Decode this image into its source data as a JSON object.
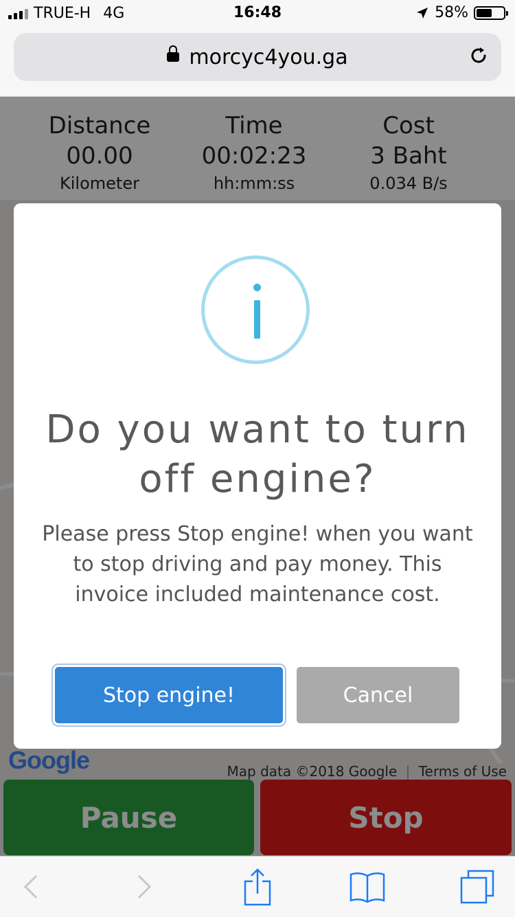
{
  "status_bar": {
    "carrier": "TRUE-H",
    "network": "4G",
    "time": "16:48",
    "battery": "58%"
  },
  "browser": {
    "url": "morcyc4you.ga"
  },
  "stats": {
    "distance": {
      "title": "Distance",
      "value": "00.00",
      "unit": "Kilometer"
    },
    "time": {
      "title": "Time",
      "value": "00:02:23",
      "unit": "hh:mm:ss"
    },
    "cost": {
      "title": "Cost",
      "value": "3 Baht",
      "unit": "0.034 B/s"
    }
  },
  "map": {
    "logo": "Google",
    "credit": "Map data ©2018 Google",
    "terms": "Terms of Use"
  },
  "buttons": {
    "pause": "Pause",
    "stop": "Stop"
  },
  "dialog": {
    "title": "Do you want to turn off engine?",
    "body": "Please press Stop engine! when you want to stop driving and pay money. This invoice included maintenance cost.",
    "confirm": "Stop engine!",
    "cancel": "Cancel"
  },
  "colors": {
    "confirm": "#3085d6",
    "cancel": "#aaaaaa",
    "pause": "#2aa140",
    "stop": "#e21b1b",
    "info": "#3fb5dd"
  },
  "toolbar": {
    "icons": [
      "back-icon",
      "forward-icon",
      "share-icon",
      "bookmarks-icon",
      "tabs-icon"
    ]
  }
}
